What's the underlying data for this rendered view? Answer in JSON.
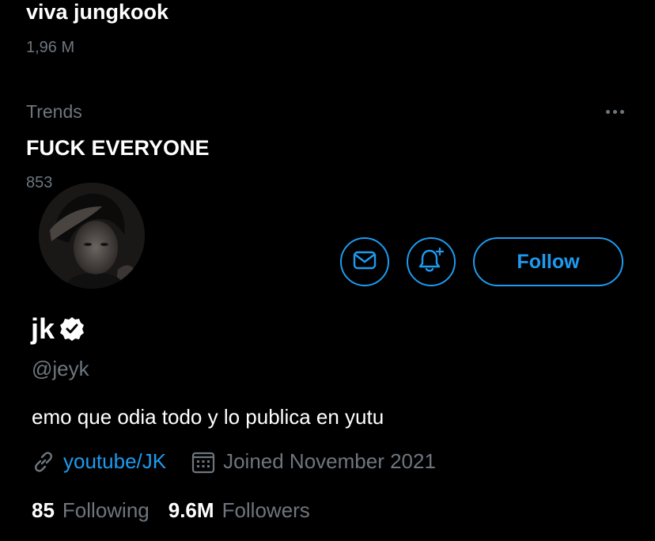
{
  "trends_list": {
    "top_trend": {
      "title": "viva jungkook",
      "count": "1,96 M"
    },
    "second_trend": {
      "category": "Trends",
      "title": "FUCK EVERYONE",
      "count": "853"
    },
    "more_icon": "more-dots-icon"
  },
  "profile": {
    "avatar_icon": "avatar",
    "display_name": "jk",
    "verified_icon": "verified-badge-icon",
    "handle": "@jeyk",
    "bio": "emo que odia todo y lo publica en yutu",
    "website": {
      "icon": "link-icon",
      "label": "youtube/JK"
    },
    "joined": {
      "icon": "calendar-icon",
      "label": "Joined November 2021"
    },
    "stats": {
      "following_count": "85",
      "following_label": "Following",
      "followers_count": "9.6M",
      "followers_label": "Followers"
    },
    "actions": {
      "message_icon": "mail-icon",
      "notify_icon": "bell-plus-icon",
      "follow_label": "Follow"
    }
  },
  "colors": {
    "background": "#000000",
    "accent": "#1d9bf0",
    "text_primary": "#ffffff",
    "text_secondary": "#6e767d"
  }
}
